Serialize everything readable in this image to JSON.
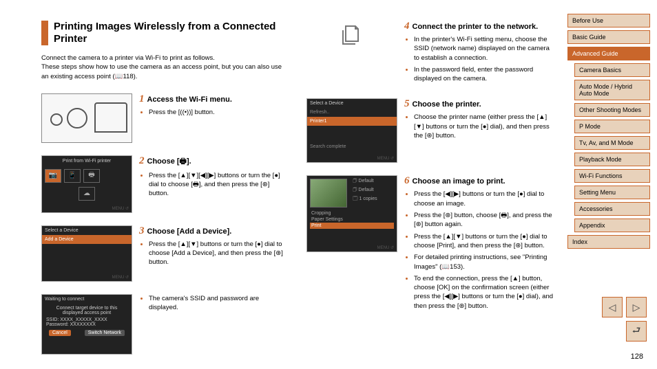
{
  "sidebar": {
    "items": [
      {
        "label": "Before Use",
        "sub": false
      },
      {
        "label": "Basic Guide",
        "sub": false
      },
      {
        "label": "Advanced Guide",
        "sub": false,
        "active": true
      },
      {
        "label": "Camera Basics",
        "sub": true
      },
      {
        "label": "Auto Mode / Hybrid Auto Mode",
        "sub": true
      },
      {
        "label": "Other Shooting Modes",
        "sub": true
      },
      {
        "label": "P Mode",
        "sub": true
      },
      {
        "label": "Tv, Av, and M Mode",
        "sub": true
      },
      {
        "label": "Playback Mode",
        "sub": true
      },
      {
        "label": "Wi-Fi Functions",
        "sub": true
      },
      {
        "label": "Setting Menu",
        "sub": true
      },
      {
        "label": "Accessories",
        "sub": true
      },
      {
        "label": "Appendix",
        "sub": true
      },
      {
        "label": "Index",
        "sub": false
      }
    ]
  },
  "page_number": "128",
  "title": "Printing Images Wirelessly from a Connected Printer",
  "intro_line1": "Connect the camera to a printer via Wi-Fi to print as follows.",
  "intro_line2": "These steps show how to use the camera as an access point, but you can also use an existing access point (📖118).",
  "steps": {
    "s1": {
      "num": "1",
      "title": "Access the Wi-Fi menu.",
      "b1": "Press the [((•))] button."
    },
    "s2": {
      "num": "2",
      "title": "Choose [🖶].",
      "b1": "Press the [▲][▼][◀][▶] buttons or turn the [●] dial to choose [🖶], and then press the [⊛] button."
    },
    "s3": {
      "num": "3",
      "title": "Choose [Add a Device].",
      "b1": "Press the [▲][▼] buttons or turn the [●] dial to choose [Add a Device], and then press the [⊛] button.",
      "b2": "The camera's SSID and password are displayed."
    },
    "s4": {
      "num": "4",
      "title": "Connect the printer to the network.",
      "b1": "In the printer's Wi-Fi setting menu, choose the SSID (network name) displayed on the camera to establish a connection.",
      "b2": "In the password field, enter the password displayed on the camera."
    },
    "s5": {
      "num": "5",
      "title": "Choose the printer.",
      "b1": "Choose the printer name (either press the [▲][▼] buttons or turn the [●] dial), and then press the [⊛] button."
    },
    "s6": {
      "num": "6",
      "title": "Choose an image to print.",
      "b1": "Press the [◀][▶] buttons or turn the [●] dial to choose an image.",
      "b2": "Press the [⊛] button, choose [🖶], and press the [⊛] button again.",
      "b3": "Press the [▲][▼] buttons or turn the [●] dial to choose [Print], and then press the [⊛] button.",
      "b4": "For detailed printing instructions, see \"Printing Images\" (📖153).",
      "b5": "To end the connection, press the [▲] button, choose [OK] on the confirmation screen (either press the [◀][▶] buttons or turn the [●] dial), and then press the [⊛] button."
    }
  },
  "screens": {
    "wifi": {
      "header": "Print from Wi-Fi printer"
    },
    "sel_add": {
      "title": "Select a Device",
      "row": "Add a Device"
    },
    "wait": {
      "title": "Waiting to connect",
      "msg": "Connect target device to this displayed access point",
      "ssid_lbl": "SSID: XXXX_XXXXX_XXXX",
      "pw_lbl": "Password: XXXXXXXX",
      "cancel": "Cancel",
      "switch": "Switch Network"
    },
    "sel_dev": {
      "title": "Select a Device",
      "refresh": "Refresh..",
      "printer": "Printer1",
      "done": "Search complete",
      "menu": "MENU ↺"
    },
    "print": {
      "r1": "🗇 Default",
      "r2": "🗇 Default",
      "r3": "🗔 1 copies",
      "r4": "Cropping",
      "r5": "Paper Settings",
      "r6": "Print",
      "menu": "MENU ↺"
    }
  }
}
